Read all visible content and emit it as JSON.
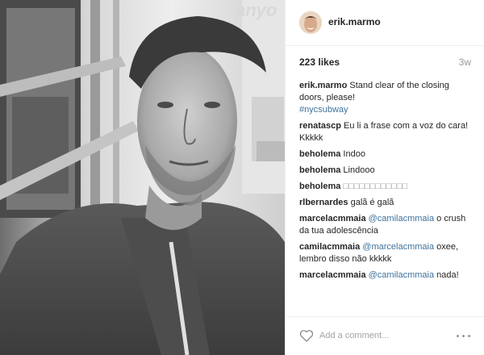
{
  "photo": {
    "alt_text_shown": false,
    "watermark": "anyo"
  },
  "header": {
    "username": "erik.marmo"
  },
  "meta": {
    "likes": "223 likes",
    "time": "3w"
  },
  "comments": [
    {
      "user": "erik.marmo",
      "parts": [
        {
          "t": "Stand clear of the closing doors, please!"
        }
      ],
      "tag": "#nycsubway"
    },
    {
      "user": "renatascp",
      "parts": [
        {
          "t": "Eu li a frase com a voz do cara! Kkkkk"
        }
      ]
    },
    {
      "user": "beholema",
      "parts": [
        {
          "t": "Indoo"
        }
      ]
    },
    {
      "user": "beholema",
      "parts": [
        {
          "t": "Lindooo"
        }
      ]
    },
    {
      "user": "beholema",
      "parts": [
        {
          "t": "□□□□□□□□□□□□"
        }
      ]
    },
    {
      "user": "rlbernardes",
      "parts": [
        {
          "t": "galã é galã"
        }
      ]
    },
    {
      "user": "marcelacmmaia",
      "parts": [
        {
          "m": "@camilacmmaia"
        },
        {
          "t": " o crush da tua adolescência"
        }
      ]
    },
    {
      "user": "camilacmmaia",
      "parts": [
        {
          "m": "@marcelacmmaia"
        },
        {
          "t": " oxee, lembro disso não kkkkk"
        }
      ]
    },
    {
      "user": "marcelacmmaia",
      "parts": [
        {
          "m": "@camilacmmaia"
        },
        {
          "t": " nada!"
        }
      ]
    }
  ],
  "footer": {
    "add_comment_placeholder": "Add a comment...",
    "like_icon": "heart-outline-icon",
    "more_icon": "more-options-icon"
  },
  "colors": {
    "mention": "#3f729b",
    "text": "#262626",
    "muted": "#999999",
    "border": "#efefef"
  }
}
